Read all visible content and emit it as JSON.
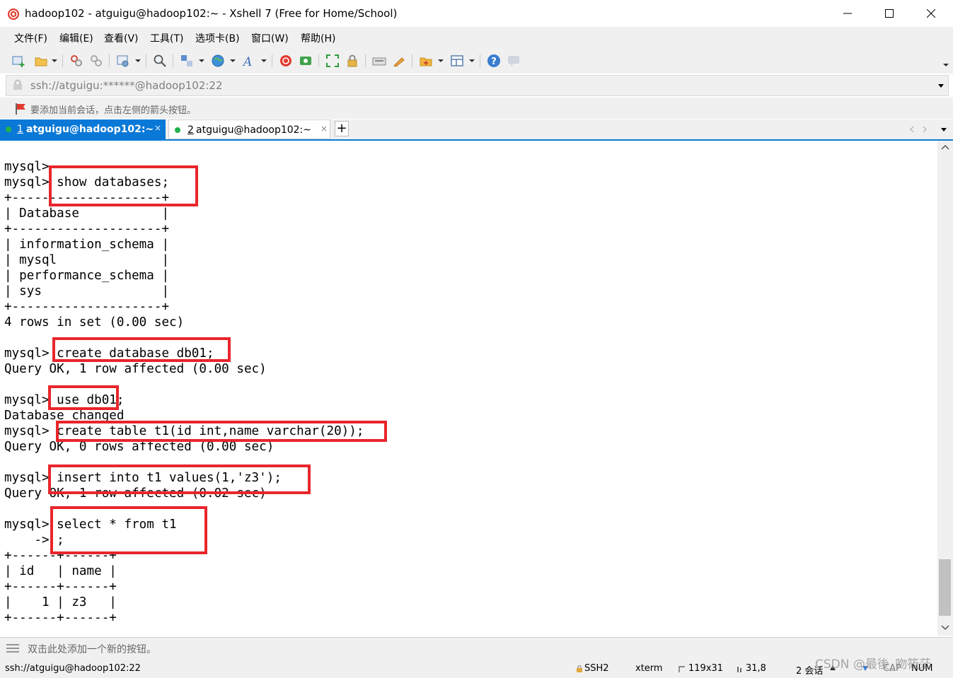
{
  "window": {
    "title": "hadoop102 - atguigu@hadoop102:~ - Xshell 7 (Free for Home/School)"
  },
  "menu": [
    "文件(F)",
    "编辑(E)",
    "查看(V)",
    "工具(T)",
    "选项卡(B)",
    "窗口(W)",
    "帮助(H)"
  ],
  "address": {
    "value": "ssh://atguigu:******@hadoop102:22"
  },
  "hint": {
    "text": "要添加当前会话，点击左侧的箭头按钮。"
  },
  "tabs": [
    {
      "number": "1",
      "label": "atguigu@hadoop102:~",
      "active": true,
      "close": "×"
    },
    {
      "number": "2",
      "label": "atguigu@hadoop102:~",
      "active": false,
      "close": "×"
    }
  ],
  "tab_add": "+",
  "terminal": {
    "lines": [
      "mysql>",
      "mysql> show databases;",
      "+--------------------+",
      "| Database           |",
      "+--------------------+",
      "| information_schema |",
      "| mysql              |",
      "| performance_schema |",
      "| sys                |",
      "+--------------------+",
      "4 rows in set (0.00 sec)",
      "",
      "mysql> create database db01;",
      "Query OK, 1 row affected (0.00 sec)",
      "",
      "mysql> use db01;",
      "Database changed",
      "mysql> create table t1(id int,name varchar(20));",
      "Query OK, 0 rows affected (0.00 sec)",
      "",
      "mysql> insert into t1 values(1,'z3');",
      "Query OK, 1 row affected (0.02 sec)",
      "",
      "mysql> select * from t1",
      "    -> ;",
      "+------+------+",
      "| id   | name |",
      "+------+------+",
      "|    1 | z3   |",
      "+------+------+"
    ]
  },
  "quickbar": {
    "text": "双击此处添加一个新的按钮。"
  },
  "status": {
    "connection": "ssh://atguigu@hadoop102:22",
    "protocol": "SSH2",
    "terminal_type": "xterm",
    "size": "119x31",
    "cursor": "31,8",
    "sessions": "2 会话",
    "cap": "CAP",
    "num": "NUM"
  },
  "watermark": "CSDN @最後_吻筱茫",
  "colors": {
    "accent": "#0a78d7",
    "highlight_box": "#e8262b",
    "status_dot": "#22b14c"
  },
  "icons": [
    "app-snail-icon",
    "minimize-icon",
    "maximize-icon",
    "close-icon",
    "new-session-icon",
    "open-folder-icon",
    "lock-icon",
    "search-icon",
    "help-icon",
    "chevron-down-icon",
    "flag-icon",
    "menu-lines-icon"
  ]
}
